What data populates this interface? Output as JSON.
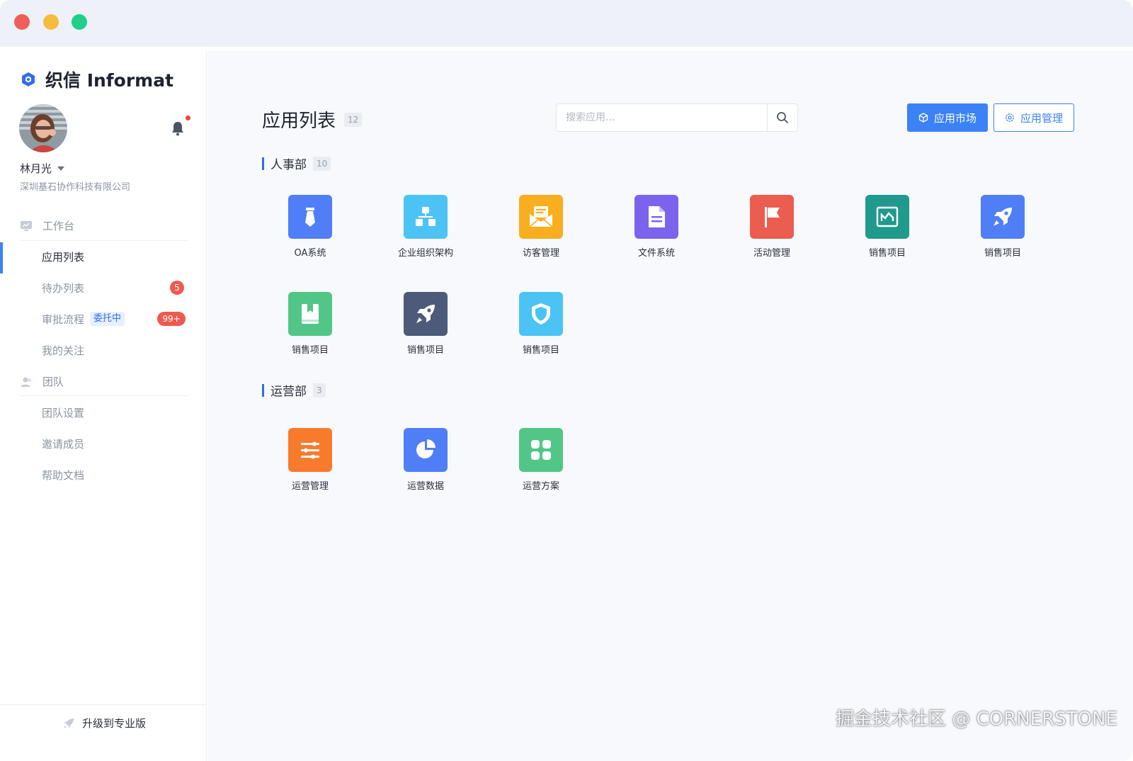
{
  "window": {
    "controls": [
      "close",
      "minimize",
      "maximize"
    ]
  },
  "brand": {
    "name": "织信 Informat",
    "accent": "#3b82f6"
  },
  "user": {
    "name": "林月光",
    "company": "深圳基石协作科技有限公司"
  },
  "sidebar": {
    "workbench_label": "工作台",
    "items": [
      {
        "label": "应用列表",
        "active": true
      },
      {
        "label": "待办列表",
        "badge": "5"
      },
      {
        "label": "审批流程",
        "tag": "委托中",
        "badge": "99+"
      },
      {
        "label": "我的关注"
      }
    ],
    "team_label": "团队",
    "team_items": [
      {
        "label": "团队设置"
      },
      {
        "label": "邀请成员"
      },
      {
        "label": "帮助文档"
      }
    ],
    "upgrade_label": "升级到专业版"
  },
  "main": {
    "title": "应用列表",
    "count": "12",
    "search": {
      "placeholder": "搜索应用..."
    },
    "buttons": {
      "market": "应用市场",
      "manage": "应用管理"
    },
    "sections": [
      {
        "name": "人事部",
        "count": "10",
        "apps": [
          {
            "label": "OA系统",
            "icon": "tie-icon",
            "color": "#4f7ef7"
          },
          {
            "label": "企业组织架构",
            "icon": "org-chart-icon",
            "color": "#4cc3f5"
          },
          {
            "label": "访客管理",
            "icon": "envelope-icon",
            "color": "#f8ae1e"
          },
          {
            "label": "文件系统",
            "icon": "document-icon",
            "color": "#7c63ee"
          },
          {
            "label": "活动管理",
            "icon": "flag-icon",
            "color": "#ea5d4f"
          },
          {
            "label": "销售项目",
            "icon": "chart-board-icon",
            "color": "#1f9a8d"
          },
          {
            "label": "销售项目",
            "icon": "rocket-icon",
            "color": "#4f7ef7"
          },
          {
            "label": "销售项目",
            "icon": "book-icon",
            "color": "#52c686"
          },
          {
            "label": "销售项目",
            "icon": "rocket-icon",
            "color": "#4d5a7a"
          },
          {
            "label": "销售项目",
            "icon": "shield-icon",
            "color": "#4cc3f5"
          }
        ]
      },
      {
        "name": "运营部",
        "count": "3",
        "apps": [
          {
            "label": "运营管理",
            "icon": "sliders-icon",
            "color": "#f87b2c"
          },
          {
            "label": "运营数据",
            "icon": "pie-chart-icon",
            "color": "#4f7ef7"
          },
          {
            "label": "运营方案",
            "icon": "grid-icon",
            "color": "#52c686"
          }
        ]
      }
    ]
  },
  "watermark": "掘金技术社区 @ CORNERSTONE"
}
